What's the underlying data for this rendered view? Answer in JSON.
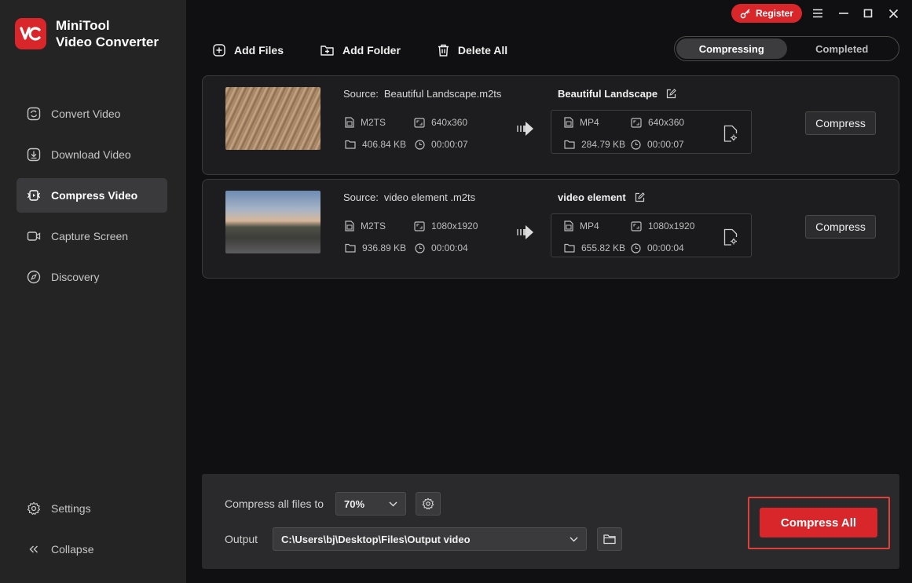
{
  "app": {
    "name_line1": "MiniTool",
    "name_line2": "Video Converter",
    "logo_text": "VC",
    "brand_color": "#d8262a"
  },
  "window": {
    "register_label": "Register"
  },
  "sidebar": {
    "items": [
      {
        "label": "Convert Video",
        "icon": "convert-icon",
        "active": false
      },
      {
        "label": "Download Video",
        "icon": "download-icon",
        "active": false
      },
      {
        "label": "Compress Video",
        "icon": "compress-icon",
        "active": true
      },
      {
        "label": "Capture Screen",
        "icon": "camera-icon",
        "active": false
      },
      {
        "label": "Discovery",
        "icon": "compass-icon",
        "active": false
      }
    ],
    "settings_label": "Settings",
    "collapse_label": "Collapse"
  },
  "toolbar": {
    "add_files": "Add Files",
    "add_folder": "Add Folder",
    "delete_all": "Delete All"
  },
  "tabs": {
    "compressing": "Compressing",
    "completed": "Completed"
  },
  "files": [
    {
      "source_label": "Source:",
      "source_name": "Beautiful Landscape.m2ts",
      "src_format": "M2TS",
      "src_resolution": "640x360",
      "src_size": "406.84 KB",
      "src_duration": "00:00:07",
      "output_name": "Beautiful Landscape",
      "out_format": "MP4",
      "out_resolution": "640x360",
      "out_size": "284.79 KB",
      "out_duration": "00:00:07",
      "button": "Compress"
    },
    {
      "source_label": "Source:",
      "source_name": "video element .m2ts",
      "src_format": "M2TS",
      "src_resolution": "1080x1920",
      "src_size": "936.89 KB",
      "src_duration": "00:00:04",
      "output_name": "video element",
      "out_format": "MP4",
      "out_resolution": "1080x1920",
      "out_size": "655.82 KB",
      "out_duration": "00:00:04",
      "button": "Compress"
    }
  ],
  "bottom": {
    "compress_all_label": "Compress all files to",
    "compress_level": "70%",
    "output_label": "Output",
    "output_path": "C:\\Users\\bj\\Desktop\\Files\\Output video",
    "compress_all_button": "Compress All"
  }
}
